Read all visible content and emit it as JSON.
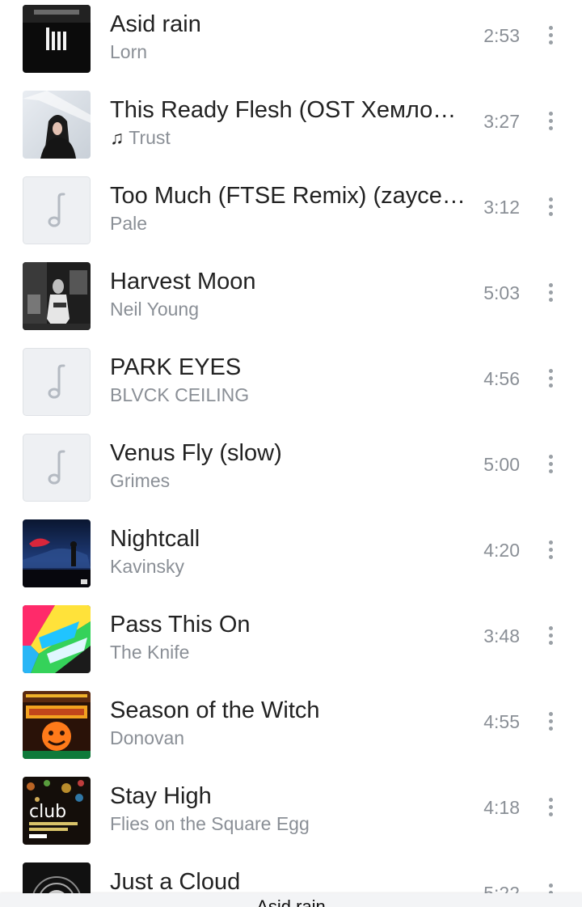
{
  "tracks": [
    {
      "title": "Asid rain",
      "artist": "Lorn",
      "duration": "2:53",
      "cover": "lorn-bars-cover",
      "has_note": false
    },
    {
      "title": "This Ready Flesh (OST Хемлок Гроув)",
      "artist": "Trust",
      "duration": "3:27",
      "cover": "photo-woman-cover",
      "has_note": true
    },
    {
      "title": "Too Much (FTSE Remix) (zaycev.net)",
      "artist": "Pale",
      "duration": "3:12",
      "cover": "music-note-placeholder",
      "has_note": false
    },
    {
      "title": "Harvest Moon",
      "artist": "Neil Young",
      "duration": "5:03",
      "cover": "neil-young-cover",
      "has_note": false
    },
    {
      "title": "PARK EYES",
      "artist": "BLVCK CEILING",
      "duration": "4:56",
      "cover": "music-note-placeholder",
      "has_note": false
    },
    {
      "title": "Venus Fly (slow)",
      "artist": "Grimes",
      "duration": "5:00",
      "cover": "music-note-placeholder",
      "has_note": false
    },
    {
      "title": "Nightcall",
      "artist": "Kavinsky",
      "duration": "4:20",
      "cover": "kavinsky-cover",
      "has_note": false
    },
    {
      "title": "Pass This On",
      "artist": "The Knife",
      "duration": "3:48",
      "cover": "the-knife-cover",
      "has_note": false
    },
    {
      "title": "Season of the Witch",
      "artist": "Donovan",
      "duration": "4:55",
      "cover": "donovan-halloween-cover",
      "has_note": false
    },
    {
      "title": "Stay High",
      "artist": "Flies on the Square Egg",
      "duration": "4:18",
      "cover": "club-anthology-cover",
      "has_note": false
    },
    {
      "title": "Just a Cloud",
      "artist": "",
      "duration": "5:22",
      "cover": "cloud-cover",
      "has_note": false
    }
  ],
  "now_playing": {
    "title": "Asid rain"
  },
  "colors": {
    "title_text": "#222222",
    "secondary_text": "#8a8f96",
    "placeholder_bg": "#eef0f3",
    "menu_dots": "#9aa0a6"
  },
  "icons": {
    "more": "more-vertical-icon",
    "note": "music-note-icon"
  }
}
